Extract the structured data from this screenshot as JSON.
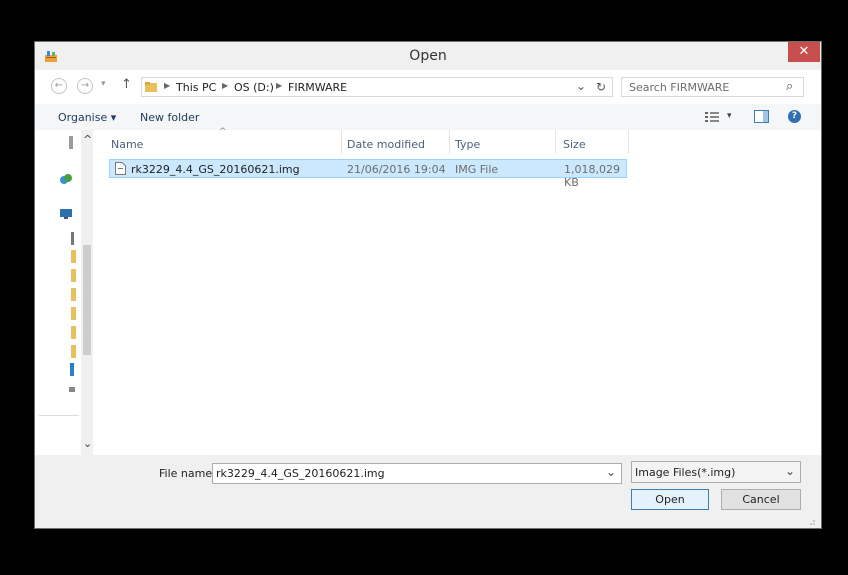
{
  "window": {
    "title": "Open",
    "close_label": "✕"
  },
  "nav": {
    "back": "←",
    "forward": "→",
    "recent": "▾",
    "up": "↑"
  },
  "address": {
    "crumbs": [
      "This PC",
      "OS (D:)",
      "FIRMWARE"
    ],
    "dropdown": "⌄",
    "refresh": "↻"
  },
  "search": {
    "placeholder": "Search FIRMWARE",
    "icon": "⌕"
  },
  "toolbar": {
    "organise": "Organise ▾",
    "new_folder": "New folder",
    "view_arrow": "▾",
    "help": "?"
  },
  "columns": {
    "name": "Name",
    "date": "Date modified",
    "type": "Type",
    "size": "Size"
  },
  "files": [
    {
      "name": "rk3229_4.4_GS_20160621.img",
      "date": "21/06/2016 19:04",
      "type": "IMG File",
      "size": "1,018,029 KB"
    }
  ],
  "scroll": {
    "up": "^",
    "down": "⌄"
  },
  "bottom": {
    "filename_label": "File name:",
    "filename_value": "rk3229_4.4_GS_20160621.img",
    "filetype": "Image Files(*.img)",
    "open": "Open",
    "cancel": "Cancel"
  }
}
